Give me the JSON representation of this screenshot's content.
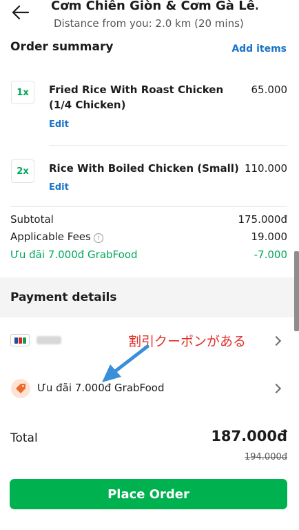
{
  "header": {
    "title": "Cơm Chiên Giòn & Cơm Gà Lê...",
    "subtitle": "Distance from you: 2.0 km (20 mins)"
  },
  "order_summary": {
    "title": "Order summary",
    "add_items_label": "Add items",
    "items": [
      {
        "qty": "1x",
        "name": "Fried Rice With Roast Chicken (1/4 Chicken)",
        "price": "65.000",
        "edit_label": "Edit"
      },
      {
        "qty": "2x",
        "name": "Rice With Boiled Chicken (Small)",
        "price": "110.000",
        "edit_label": "Edit"
      }
    ],
    "subtotal_label": "Subtotal",
    "subtotal_value": "175.000đ",
    "fees_label": "Applicable Fees",
    "fees_value": "19.000",
    "discount_label": "Ưu đãi 7.000đ GrabFood",
    "discount_value": "-7.000"
  },
  "payment": {
    "title": "Payment details",
    "annotation": "割引クーポンがある",
    "promo_label": "Ưu đãi 7.000đ GrabFood"
  },
  "total": {
    "label": "Total",
    "value": "187.000đ",
    "old_value": "194.000đ"
  },
  "place_order_label": "Place Order",
  "colors": {
    "brand_green": "#00b14f",
    "link_blue": "#1a73c8",
    "discount_green": "#00a85a",
    "annotation_red": "#e0302a"
  },
  "icons": [
    "back-arrow-icon",
    "info-icon",
    "jcb-card-icon",
    "chevron-right-icon",
    "promo-tag-icon",
    "annotation-arrow-icon"
  ]
}
